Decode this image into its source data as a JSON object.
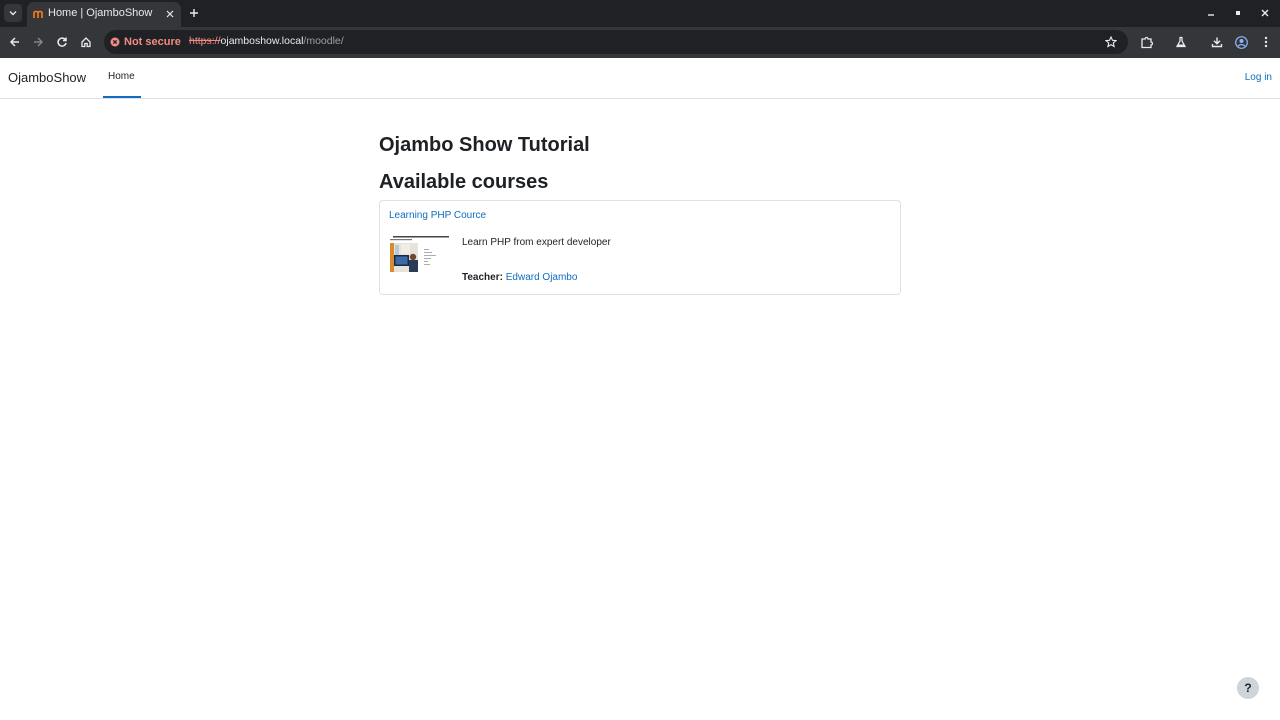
{
  "browser": {
    "tab_title": "Home | OjamboShow",
    "security_label": "Not secure",
    "url_scheme": "https://",
    "url_host": "ojamboshow.local",
    "url_path": "/moodle/"
  },
  "site": {
    "brand": "OjamboShow",
    "nav_home": "Home",
    "login": "Log in"
  },
  "main": {
    "page_title": "Ojambo Show Tutorial",
    "section_title": "Available courses",
    "course": {
      "name": "Learning PHP Cource",
      "summary": "Learn PHP from expert developer",
      "teacher_label": "Teacher:",
      "teacher_name": "Edward Ojambo"
    }
  },
  "help": {
    "label": "?"
  },
  "colors": {
    "link": "#0f6cbf",
    "warning": "#f28b82",
    "chrome_dark": "#202124",
    "chrome_mid": "#35363a"
  }
}
